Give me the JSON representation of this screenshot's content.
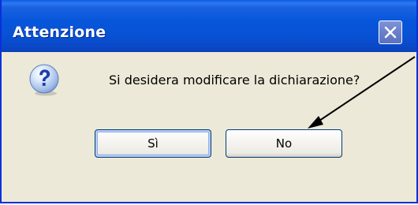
{
  "dialog": {
    "title": "Attenzione",
    "message": "Si desidera modificare la dichiarazione?",
    "icon": "question-icon",
    "close_icon": "close-icon"
  },
  "buttons": {
    "yes_label": "Sì",
    "no_label": "No"
  },
  "colors": {
    "titlebar": "#0a5ee5",
    "window_border": "#0831d9",
    "dialog_background": "#ece9d8",
    "close_button": "#6a7fcb",
    "button_border": "#003c74",
    "annotation_arrow": "#000000"
  }
}
